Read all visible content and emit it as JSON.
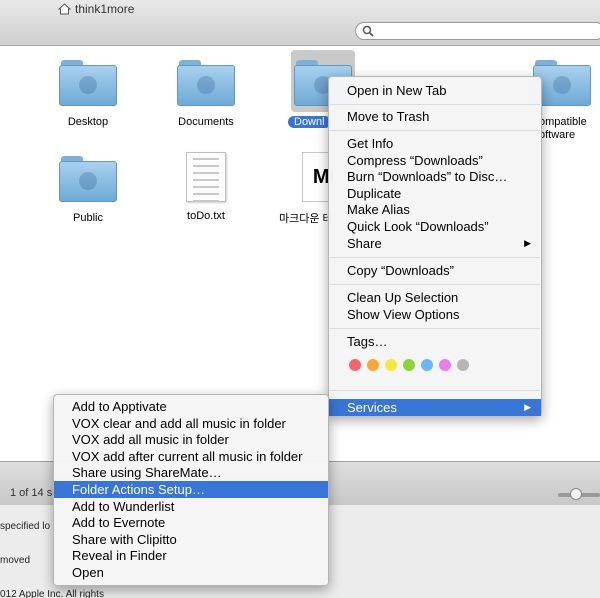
{
  "window": {
    "title": "think1more"
  },
  "items": [
    {
      "label": "Desktop",
      "type": "folder"
    },
    {
      "label": "Documents",
      "type": "folder"
    },
    {
      "label": "Downl",
      "type": "folder-selected"
    },
    {
      "label": "Public",
      "type": "folder"
    },
    {
      "label": "toDo.txt",
      "type": "text"
    },
    {
      "label": "마크다운 테",
      "type": "markdown"
    },
    {
      "label": "ompatible",
      "label2": "oftware",
      "type": "folder"
    }
  ],
  "md_icon_text": "MI",
  "status": {
    "items_text": "1 of 14 s"
  },
  "lower": {
    "line1": "specified lo",
    "line2": "moved",
    "line3": "012 Apple Inc.  All rights"
  },
  "context_menu": {
    "items": [
      {
        "label": "Open in New Tab"
      },
      {
        "label": "Move to Trash"
      },
      {
        "label": "Get Info"
      },
      {
        "label": "Compress “Downloads”"
      },
      {
        "label": "Burn “Downloads” to Disc…"
      },
      {
        "label": "Duplicate"
      },
      {
        "label": "Make Alias"
      },
      {
        "label": "Quick Look “Downloads”"
      },
      {
        "label": "Share"
      },
      {
        "label": "Copy “Downloads”"
      },
      {
        "label": "Clean Up Selection"
      },
      {
        "label": "Show View Options"
      },
      {
        "label": "Tags…"
      },
      {
        "label": "Services"
      }
    ],
    "submenu_arrow": "▶",
    "tag_colors": [
      "#f2676b",
      "#f7a63a",
      "#f5e83c",
      "#8ad43a",
      "#6ab7f2",
      "#e77fe8",
      "#b5b5b5"
    ]
  },
  "services_menu": {
    "items": [
      {
        "label": "Add to Apptivate"
      },
      {
        "label": "VOX clear and add all music in folder"
      },
      {
        "label": "VOX add all music in folder"
      },
      {
        "label": "VOX add after current all music in folder"
      },
      {
        "label": "Share using ShareMate…"
      },
      {
        "label": "Folder Actions Setup…"
      },
      {
        "label": "Add to Wunderlist"
      },
      {
        "label": "Add to Evernote"
      },
      {
        "label": "Share with Clipitto"
      },
      {
        "label": "Reveal in Finder"
      },
      {
        "label": "Open"
      }
    ]
  },
  "colors": {
    "highlight": "#3875d7"
  }
}
